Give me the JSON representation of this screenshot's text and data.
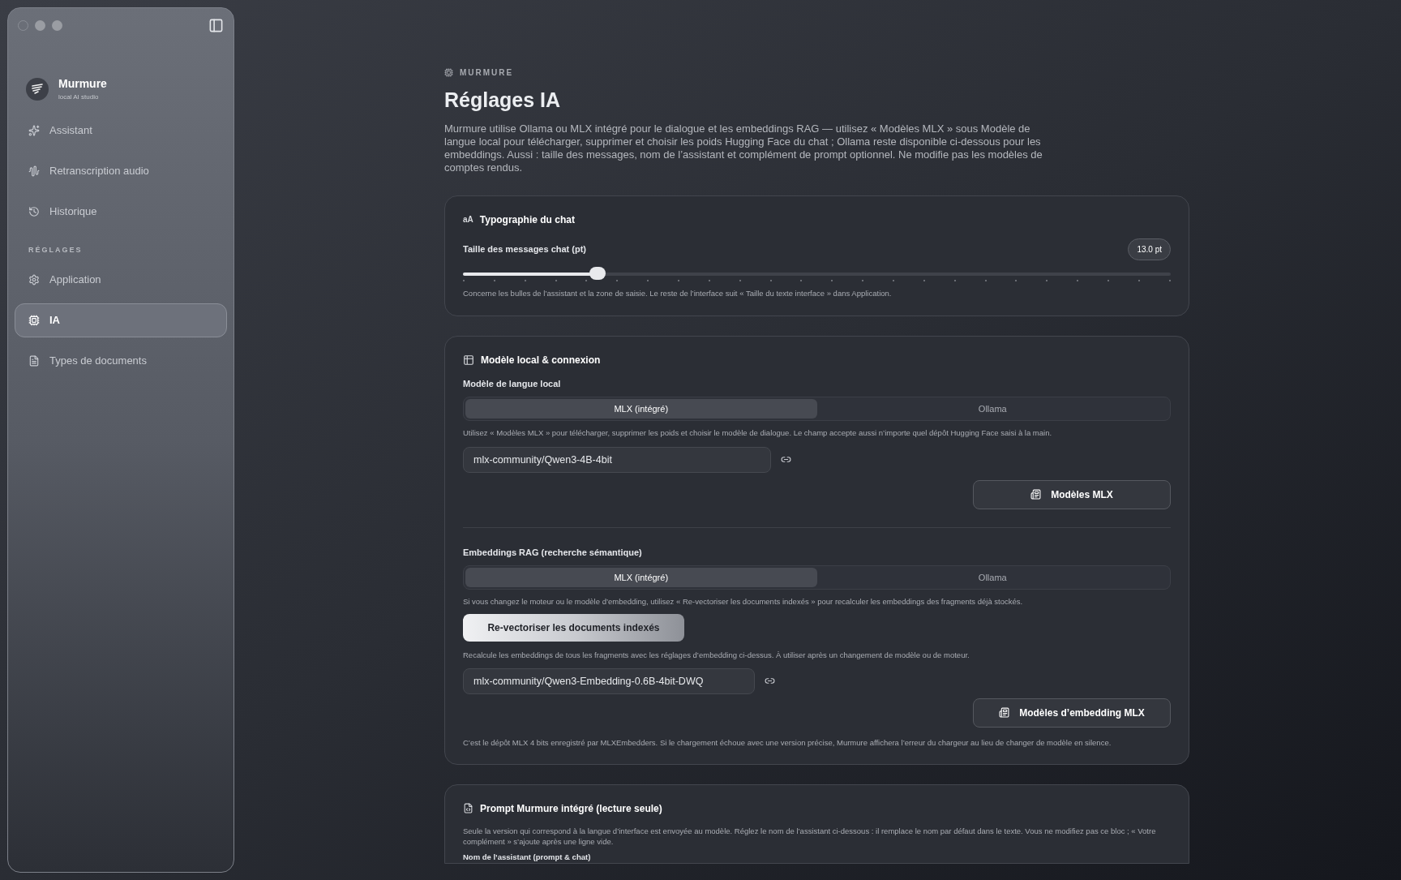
{
  "sidebar": {
    "app_name": "Murmure",
    "app_subtitle": "local AI studio",
    "items": [
      {
        "label": "Assistant",
        "kind": "sparkles",
        "selected": false
      },
      {
        "label": "Retranscription audio",
        "kind": "wave",
        "selected": false
      },
      {
        "label": "Historique",
        "kind": "history",
        "selected": false
      }
    ],
    "section_label": "RÉGLAGES",
    "settings_items": [
      {
        "label": "Application",
        "kind": "gear",
        "selected": false
      },
      {
        "label": "IA",
        "kind": "chip",
        "selected": true
      },
      {
        "label": "Types de documents",
        "kind": "document",
        "selected": false
      }
    ]
  },
  "header": {
    "eyebrow": "MURMURE",
    "title": "Réglages IA",
    "description": "Murmure utilise Ollama ou MLX intégré pour le dialogue et les embeddings RAG — utilisez « Modèles MLX » sous Modèle de langue local pour télécharger, supprimer et choisir les poids Hugging Face du chat ; Ollama reste disponible ci-dessous pour les embeddings. Aussi : taille des messages, nom de l’assistant et complément de prompt optionnel. Ne modifie pas les modèles de comptes rendus."
  },
  "typography_card": {
    "icon_text": "aA",
    "title": "Typographie du chat",
    "slider_label": "Taille des messages chat (pt)",
    "reading": "13.0 pt",
    "level": 0.19,
    "help": "Concerne les bulles de l’assistant et la zone de saisie. Le reste de l’interface suit « Taille du texte interface » dans Application."
  },
  "model_card": {
    "title": "Modèle local & connexion",
    "llm": {
      "label": "Modèle de langue local",
      "options": [
        {
          "label": "MLX (intégré)",
          "selected": true
        },
        {
          "label": "Ollama",
          "selected": false
        }
      ],
      "help": "Utilisez « Modèles MLX » pour télécharger, supprimer les poids et choisir le modèle de dialogue. Le champ accepte aussi n’importe quel dépôt Hugging Face saisi à la main.",
      "value": "mlx-community/Qwen3-4B-4bit",
      "button": "Modèles MLX"
    },
    "embeddings": {
      "label": "Embeddings RAG (recherche sémantique)",
      "options": [
        {
          "label": "MLX (intégré)",
          "selected": true
        },
        {
          "label": "Ollama",
          "selected": false
        }
      ],
      "help": "Si vous changez le moteur ou le modèle d’embedding, utilisez « Re-vectoriser les documents indexés » pour recalculer les embeddings des fragments déjà stockés.",
      "revector_button": "Re-vectoriser les documents indexés",
      "revector_help": "Recalcule les embeddings de tous les fragments avec les réglages d’embedding ci-dessus. À utiliser après un changement de modèle ou de moteur.",
      "value": "mlx-community/Qwen3-Embedding-0.6B-4bit-DWQ",
      "button": "Modèles d’embedding MLX",
      "footer": "C’est le dépôt MLX 4 bits enregistré par MLXEmbedders. Si le chargement échoue avec une version précise, Murmure affichera l’erreur du chargeur au lieu de changer de modèle en silence."
    }
  },
  "prompt_card": {
    "title": "Prompt Murmure intégré (lecture seule)",
    "help": "Seule la version qui correspond à la langue d’interface est envoyée au modèle. Réglez le nom de l’assistant ci-dessous : il remplace le nom par défaut dans le texte. Vous ne modifiez pas ce bloc ; « Votre complément » s’ajoute après une ligne vide.",
    "field_label": "Nom de l’assistant (prompt & chat)"
  }
}
